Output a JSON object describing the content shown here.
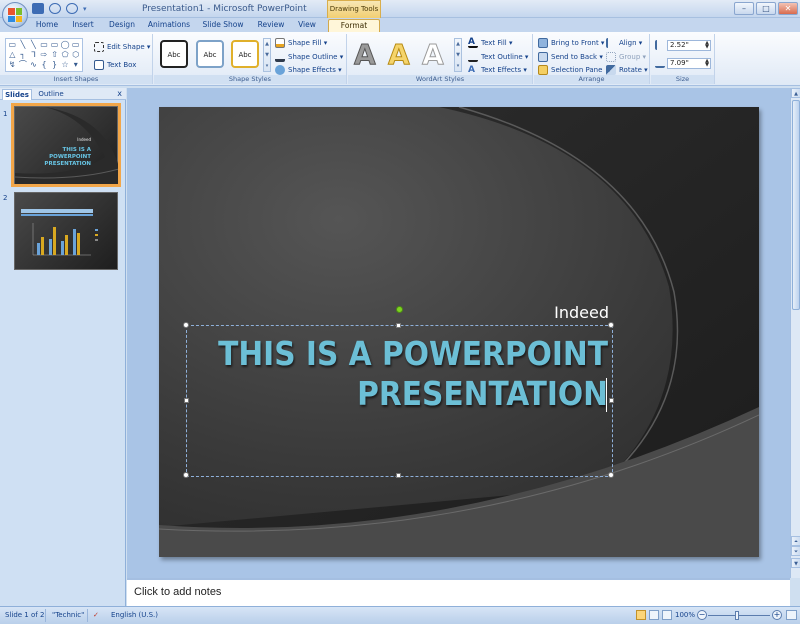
{
  "window": {
    "title": "Presentation1 - Microsoft PowerPoint",
    "contextual_tab": "Drawing Tools",
    "controls": [
      "–",
      "□",
      "✕"
    ]
  },
  "tabs": [
    "Home",
    "Insert",
    "Design",
    "Animations",
    "Slide Show",
    "Review",
    "View",
    "Format"
  ],
  "ribbon": {
    "insert_shapes": {
      "label": "Insert Shapes",
      "shape_glyphs": [
        "▭",
        "╲",
        "╲",
        "▭",
        "▭",
        "◯",
        "▭",
        "△",
        "┐",
        "ᒣ",
        "⇨",
        "⇧",
        "⬠",
        "⬡",
        "↯",
        "⌒",
        "∿",
        "{",
        "}",
        "☆",
        "▾"
      ],
      "edit_shape": "Edit Shape ▾",
      "text_box": "Text Box"
    },
    "shape_styles": {
      "label": "Shape Styles",
      "style_samples": [
        "Abc",
        "Abc",
        "Abc"
      ],
      "shape_fill": "Shape Fill ▾",
      "shape_outline": "Shape Outline ▾",
      "shape_effects": "Shape Effects ▾"
    },
    "wordart_styles": {
      "label": "WordArt Styles",
      "letters": [
        "A",
        "A",
        "A"
      ],
      "text_fill": "Text Fill ▾",
      "text_outline": "Text Outline ▾",
      "text_effects": "Text Effects ▾"
    },
    "arrange": {
      "label": "Arrange",
      "bring_to_front": "Bring to Front ▾",
      "send_to_back": "Send to Back ▾",
      "selection_pane": "Selection Pane",
      "align": "Align ▾",
      "group": "Group ▾",
      "rotate": "Rotate ▾"
    },
    "size": {
      "label": "Size",
      "height": "2.52\"",
      "width": "7.09\""
    }
  },
  "left_pane": {
    "tabs": [
      "Slides",
      "Outline"
    ],
    "close": "x",
    "slides": [
      {
        "number": "1",
        "subtitle": "Indeed",
        "title": "THIS IS A POWERPOINT PRESENTATION"
      },
      {
        "number": "2"
      }
    ]
  },
  "slide": {
    "subtitle": "Indeed",
    "title_line1": "THIS IS A POWERPOINT",
    "title_line2": "PRESENTATION"
  },
  "notes": {
    "placeholder": "Click to add notes"
  },
  "status": {
    "slide_info": "Slide 1 of 2",
    "theme": "\"Technic\"",
    "language": "English (U.S.)",
    "zoom": "100%"
  },
  "colors": {
    "accent_title": "#6cbfd6",
    "selected_thumb": "#f2a649",
    "ribbon_blue": "#15428b"
  }
}
